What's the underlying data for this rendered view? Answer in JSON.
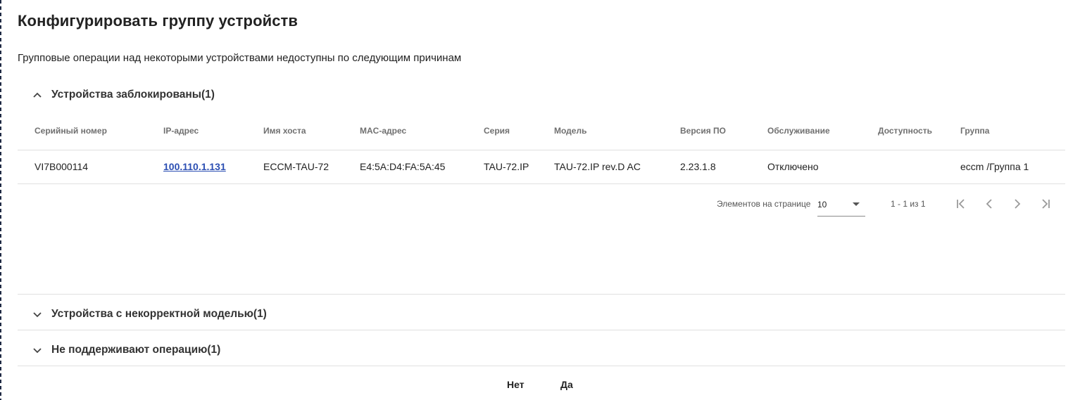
{
  "dialog": {
    "title": "Конфигурировать группу устройств",
    "subtitle": "Групповые операции над некоторыми устройствами недоступны по следующим причинам"
  },
  "panels": [
    {
      "title": "Устройства заблокированы(1)",
      "expanded": true
    },
    {
      "title": "Устройства с некорректной моделью(1)",
      "expanded": false
    },
    {
      "title": "Не поддерживают операцию(1)",
      "expanded": false
    }
  ],
  "table": {
    "columns": [
      "Серийный номер",
      "IP-адрес",
      "Имя хоста",
      "MAC-адрес",
      "Серия",
      "Модель",
      "Версия ПО",
      "Обслуживание",
      "Доступность",
      "Группа"
    ],
    "rows": [
      [
        "VI7B000114",
        "100.110.1.131",
        "ECCM-TAU-72",
        "E4:5A:D4:FA:5A:45",
        "TAU-72.IP",
        "TAU-72.IP rev.D AC",
        "2.23.1.8",
        "Отключено",
        "",
        "eccm /Группа 1"
      ]
    ]
  },
  "paginator": {
    "items_per_page_label": "Элементов на странице",
    "items_per_page": "10",
    "range": "1 - 1 из 1"
  },
  "actions": {
    "no_label": "Нет",
    "yes_label": "Да"
  },
  "colors": {
    "link": "#2c4fb3",
    "divider": "#e0e0e0",
    "header_text": "#707070"
  }
}
